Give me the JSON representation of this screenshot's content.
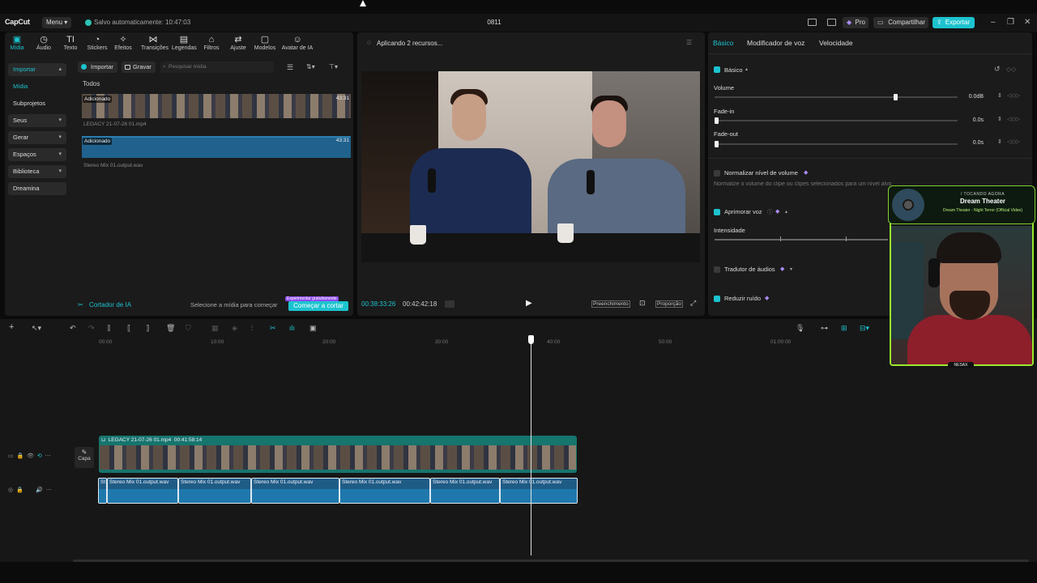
{
  "title_bar": {
    "logo": "CapCut",
    "menu": "Menu",
    "saved_status": "Salvo automaticamente: 10:47:03",
    "project_name": "0811",
    "pro": "Pro",
    "share": "Compartilhar",
    "export": "Exportar"
  },
  "toolbar": {
    "items": [
      {
        "label": "Mídia",
        "icon": "media-icon"
      },
      {
        "label": "Áudio",
        "icon": "audio-icon"
      },
      {
        "label": "Texto",
        "icon": "text-icon"
      },
      {
        "label": "Stickers",
        "icon": "sticker-icon"
      },
      {
        "label": "Efeitos",
        "icon": "effects-icon"
      },
      {
        "label": "Transições",
        "icon": "transition-icon"
      },
      {
        "label": "Legendas",
        "icon": "captions-icon"
      },
      {
        "label": "Filtros",
        "icon": "filter-icon"
      },
      {
        "label": "Ajuste",
        "icon": "adjust-icon"
      },
      {
        "label": "Modelos",
        "icon": "templates-icon"
      },
      {
        "label": "Avatar de IA",
        "icon": "avatar-icon"
      }
    ]
  },
  "sidebar": {
    "items": [
      {
        "label": "Importar"
      },
      {
        "label": "Mídia"
      },
      {
        "label": "Subprojetos"
      },
      {
        "label": "Seus"
      },
      {
        "label": "Gerar"
      },
      {
        "label": "Espaços"
      },
      {
        "label": "Biblioteca"
      },
      {
        "label": "Dreamina"
      }
    ]
  },
  "media": {
    "import_btn": "Importar",
    "record_btn": "Gravar",
    "search_placeholder": "Pesquisar mídia",
    "section": "Todos",
    "clips": [
      {
        "badge": "Adicionado",
        "duration": "43:31",
        "name": "LEGACY 21-07-26 01.mp4"
      },
      {
        "badge": "Adicionado",
        "duration": "43:31",
        "name": "Stereo Mix 01.output.wav"
      }
    ]
  },
  "ai_cut": {
    "label": "Cortador de IA",
    "hint": "Selecione a mídia para começar",
    "promo": "Experimentar gratuitamente",
    "action": "Começar a cortar"
  },
  "preview": {
    "status": "Aplicando 2 recursos...",
    "timecode": "00:38:33:26",
    "duration": "00:42:42:18",
    "fill": "Preenchimento",
    "ratio": "Proporção"
  },
  "right": {
    "tabs": [
      "Básico",
      "Modificador de voz",
      "Velocidade"
    ],
    "section": "Básico",
    "volume_label": "Volume",
    "volume_value": "0.0dB",
    "fadein_label": "Fade-in",
    "fadein_value": "0.0s",
    "fadeout_label": "Fade-out",
    "fadeout_value": "0.0s",
    "normalize_label": "Normalizar nível de volume",
    "normalize_hint": "Normalize o volume do clipe ou clipes selecionados para um nível alvo",
    "enhance_label": "Aprimorar voz",
    "intensity_label": "Intensidade",
    "translator_label": "Tradutor de áudios",
    "noise_label": "Reduzir ruído"
  },
  "timeline": {
    "ruler": [
      "00:00",
      "10:00",
      "20:00",
      "30:00",
      "40:00",
      "50:00",
      "01:00:00"
    ],
    "cover": "Capa",
    "video_clip": "LEGACY 21-07-26 01.mp4",
    "video_duration": "00:41:58:14",
    "audio_clips": [
      "St",
      "Stereo Mix 01.output.wav",
      "Stereo Mix 01.output.wav",
      "Stereo Mix 01.output.wav",
      "Stereo Mix 01.output.wav",
      "Stereo Mix 01.output.wav",
      "Stereo Mix 01.output.wav"
    ]
  },
  "overlay": {
    "tag": "/ TOCANDO AGORA",
    "artist": "Dream Theater",
    "song": "Dream Theater - Night Terror (Official Video)",
    "brand": "NESAX"
  },
  "colors": {
    "accent": "#1cc3cf",
    "video_track": "#16756d",
    "audio_track": "#1f5c85",
    "overlay_border": "#9be82f"
  }
}
